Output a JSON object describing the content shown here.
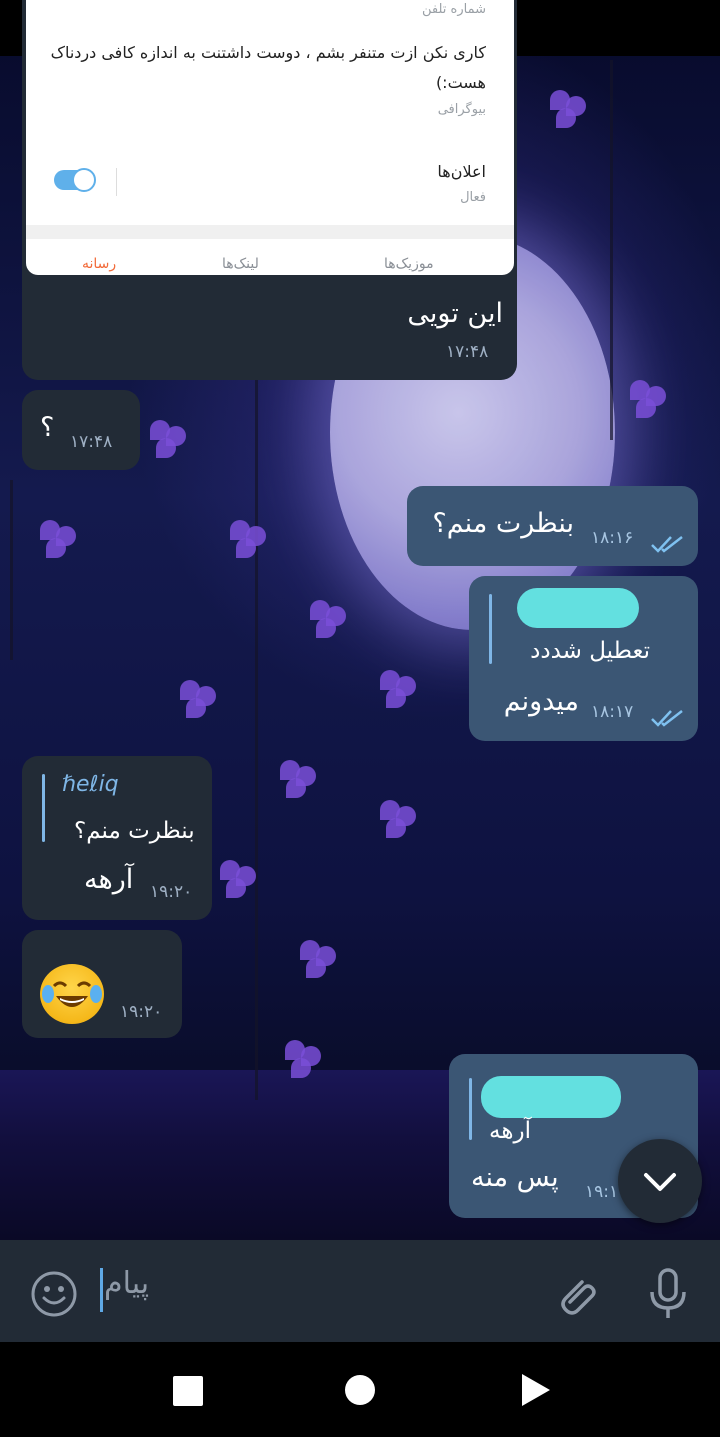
{
  "profile_card": {
    "phone_label": "شماره تلفن",
    "bio": "کاری نکن ازت متنفر بشم ، دوست داشتنت به اندازه کافی دردناک هست:)",
    "bio_label": "بیوگرافی",
    "notifications_label": "اعلان‌ها",
    "notifications_state": "فعال",
    "tabs": [
      "موزیک‌ها",
      "لینک‌ها",
      "رسانه"
    ],
    "active_tab": "رسانه"
  },
  "messages": [
    {
      "direction": "incoming",
      "text": "این تویی",
      "time": "۱۷:۴۸"
    },
    {
      "direction": "incoming",
      "text": "؟",
      "time": "۱۷:۴۸"
    },
    {
      "direction": "outgoing",
      "text": "بنظرت منم؟",
      "time": "۱۸:۱۶",
      "status": "read"
    },
    {
      "direction": "outgoing",
      "reply_text": "تعطیل شددد",
      "text": "میدونم",
      "time": "۱۸:۱۷",
      "status": "read"
    },
    {
      "direction": "incoming",
      "reply_name": "ℏeℓiq",
      "reply_text": "بنظرت منم؟",
      "text": "آرهه",
      "time": "۱۹:۲۰"
    },
    {
      "direction": "incoming",
      "text": "😂",
      "time": "۱۹:۲۰"
    },
    {
      "direction": "outgoing",
      "reply_text": "آرهه",
      "text": "پس منه",
      "time": "۱۹:۱"
    }
  ],
  "composer": {
    "placeholder": "پیام"
  },
  "icons": {
    "emoji": "emoji-icon",
    "attach": "paperclip-icon",
    "mic": "microphone-icon",
    "scroll_down": "chevron-down-icon",
    "nav_recent": "square-icon",
    "nav_home": "circle-icon",
    "nav_back": "triangle-icon"
  },
  "colors": {
    "incoming_bubble": "#222b36",
    "outgoing_bubble": "#3b5674",
    "accent": "#5fa9e6",
    "active_tab": "#f26b3a"
  }
}
